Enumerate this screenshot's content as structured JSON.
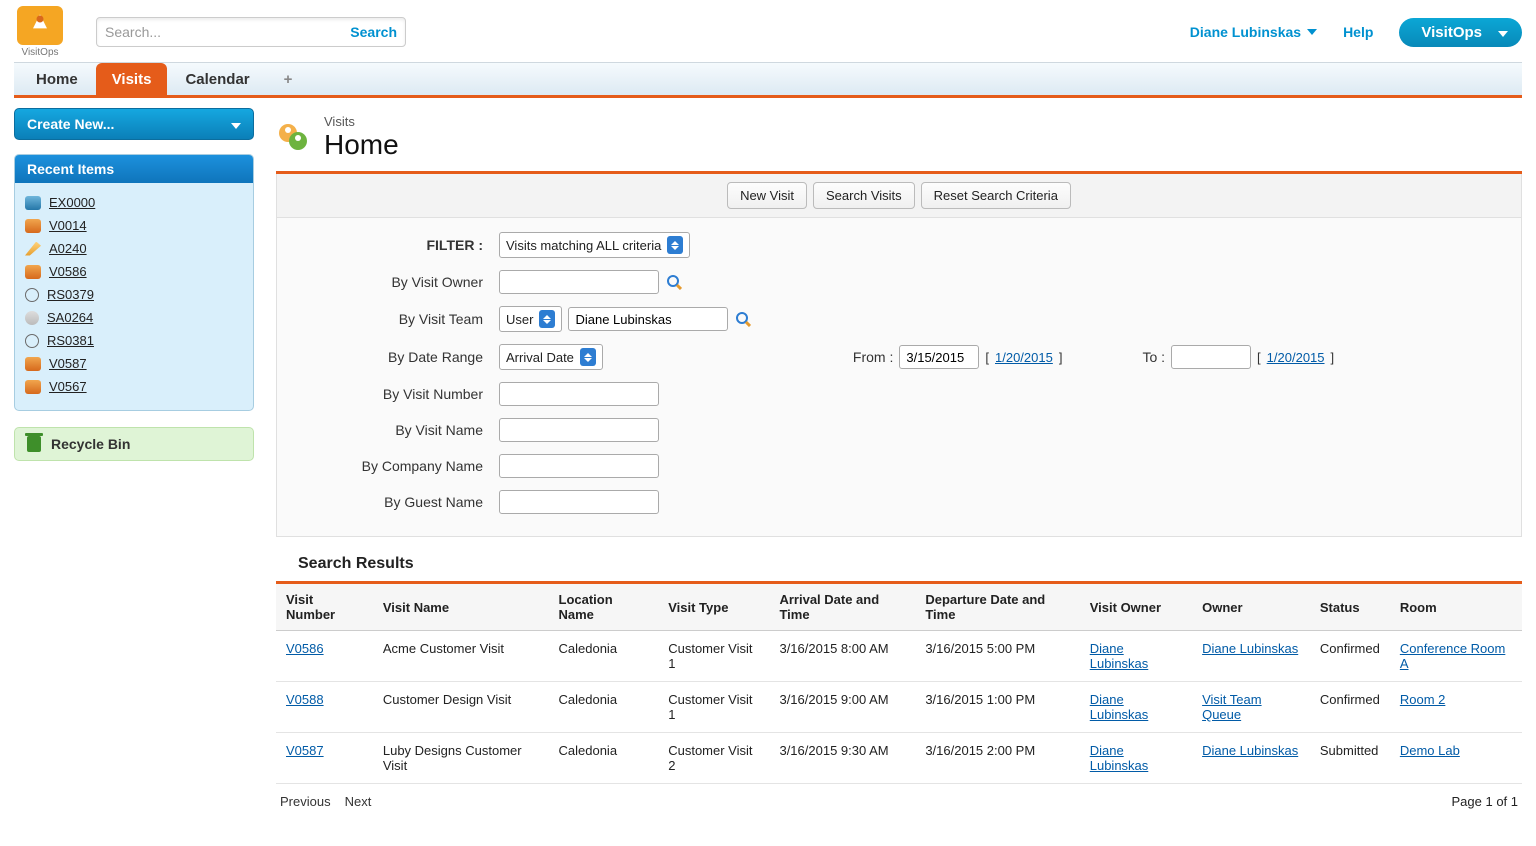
{
  "logo_text": "VisitOps",
  "search_placeholder": "Search...",
  "search_button": "Search",
  "user_menu": "Diane Lubinskas",
  "help_link": "Help",
  "app_button": "VisitOps",
  "tabs": {
    "home": "Home",
    "visits": "Visits",
    "calendar": "Calendar"
  },
  "create_new": "Create New...",
  "recent_items_header": "Recent Items",
  "recent_items": [
    {
      "label": "EX0000",
      "icon": "ic-blue"
    },
    {
      "label": "V0014",
      "icon": "ic-visit"
    },
    {
      "label": "A0240",
      "icon": "ic-pen"
    },
    {
      "label": "V0586",
      "icon": "ic-visit"
    },
    {
      "label": "RS0379",
      "icon": "ic-clock"
    },
    {
      "label": "SA0264",
      "icon": "ic-gray"
    },
    {
      "label": "RS0381",
      "icon": "ic-clock"
    },
    {
      "label": "V0587",
      "icon": "ic-visit"
    },
    {
      "label": "V0567",
      "icon": "ic-visit"
    }
  ],
  "recycle_bin": "Recycle Bin",
  "page_crumb": "Visits",
  "page_title": "Home",
  "toolbar_buttons": {
    "new": "New Visit",
    "search": "Search Visits",
    "reset": "Reset Search Criteria"
  },
  "filter": {
    "label": "FILTER :",
    "mode": "Visits matching ALL criteria",
    "by_owner_label": "By Visit Owner",
    "by_team_label": "By Visit Team",
    "team_type": "User",
    "team_value": "Diane Lubinskas",
    "by_date_label": "By Date Range",
    "date_type": "Arrival Date",
    "from_label": "From :",
    "from_value": "3/15/2015",
    "from_today": "1/20/2015",
    "to_label": "To :",
    "to_value": "",
    "to_today": "1/20/2015",
    "by_number_label": "By Visit Number",
    "by_name_label": "By Visit Name",
    "by_company_label": "By Company Name",
    "by_guest_label": "By Guest Name"
  },
  "results_header": "Search Results",
  "columns": {
    "num": "Visit Number",
    "name": "Visit Name",
    "loc": "Location Name",
    "type": "Visit Type",
    "arr": "Arrival Date and Time",
    "dep": "Departure Date and Time",
    "vowner": "Visit Owner",
    "owner": "Owner",
    "status": "Status",
    "room": "Room"
  },
  "rows": [
    {
      "num": "V0586",
      "name": "Acme Customer Visit",
      "loc": "Caledonia",
      "type": "Customer Visit 1",
      "arr": "3/16/2015 8:00 AM",
      "dep": "3/16/2015 5:00 PM",
      "vowner": "Diane Lubinskas",
      "owner": "Diane Lubinskas",
      "status": "Confirmed",
      "room": "Conference Room A"
    },
    {
      "num": "V0588",
      "name": "Customer Design Visit",
      "loc": "Caledonia",
      "type": "Customer Visit 1",
      "arr": "3/16/2015 9:00 AM",
      "dep": "3/16/2015 1:00 PM",
      "vowner": "Diane Lubinskas",
      "owner": "Visit Team Queue",
      "status": "Confirmed",
      "room": "Room 2"
    },
    {
      "num": "V0587",
      "name": "Luby Designs Customer Visit",
      "loc": "Caledonia",
      "type": "Customer Visit 2",
      "arr": "3/16/2015 9:30 AM",
      "dep": "3/16/2015 2:00 PM",
      "vowner": "Diane Lubinskas",
      "owner": "Diane Lubinskas",
      "status": "Submitted",
      "room": "Demo Lab"
    }
  ],
  "pager": {
    "prev": "Previous",
    "next": "Next",
    "info": "Page 1 of 1"
  }
}
